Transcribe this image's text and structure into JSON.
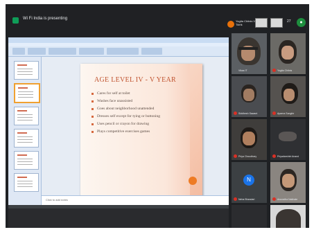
{
  "topbar": {
    "presenting_text": "Wi Fi India is presenting",
    "presenter_name": "Yogita Chitnis Vikas IT Tidrik",
    "participant_count": "27"
  },
  "slide": {
    "title": "AGE LEVEL  IV - V YEAR",
    "bullets": [
      "Cares for self at toilet",
      "Washes face unassisted",
      "Goes about neighborhood unattended",
      "Dresses self except for tying or buttoning",
      "Uses pencil or crayon for drawing",
      "Plays competitive exercises games"
    ]
  },
  "notes_text": "Click to add notes",
  "participants": [
    {
      "name": "Vikas IT",
      "muted": false
    },
    {
      "name": "Yogita Chitnis",
      "muted": true
    },
    {
      "name": "Siddhesh Sawant",
      "muted": true
    },
    {
      "name": "Aparna Songhir",
      "muted": true
    },
    {
      "name": "Priya Choudhary",
      "muted": true
    },
    {
      "name": "Priyadarshini Anand",
      "muted": true
    },
    {
      "name": "Neha Bhandari",
      "muted": true,
      "initial": "N"
    },
    {
      "name": "Anuradha Nakhate",
      "muted": true
    }
  ]
}
